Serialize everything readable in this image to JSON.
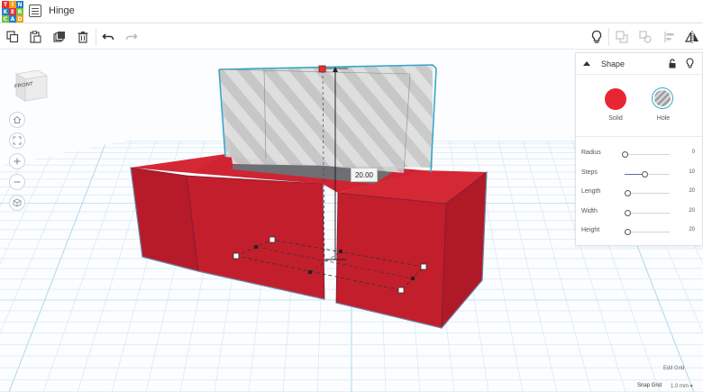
{
  "app": {
    "logo_letters": [
      "T",
      "I",
      "N",
      "K",
      "E",
      "R",
      "C",
      "A",
      "D"
    ],
    "logo_colors": [
      "#e62f2f",
      "#f7a21b",
      "#1f7fc4",
      "#1f7fc4",
      "#e62f2f",
      "#7ac143",
      "#7ac143",
      "#1f7fc4",
      "#f7a21b"
    ],
    "title": "Hinge"
  },
  "viewcube": {
    "face_label": "FRONT"
  },
  "dimension": {
    "value": "20.00"
  },
  "panel": {
    "title": "Shape",
    "solid_label": "Solid",
    "hole_label": "Hole",
    "solid_color": "#e82633",
    "properties": [
      {
        "label": "Radius",
        "value": "0",
        "fraction": 0.0
      },
      {
        "label": "Steps",
        "value": "10",
        "fraction": 0.44
      },
      {
        "label": "Length",
        "value": "20",
        "fraction": 0.06
      },
      {
        "label": "Width",
        "value": "20",
        "fraction": 0.06
      },
      {
        "label": "Height",
        "value": "20",
        "fraction": 0.06
      }
    ]
  },
  "footer": {
    "edit_grid": "Edit Grid",
    "snap_grid": "Snap Grid",
    "snap_value": "1.0 mm ▾"
  },
  "colors": {
    "accent": "#5c6ba8",
    "box_red": "#c01f2b",
    "selection": "#3aa6c9"
  }
}
